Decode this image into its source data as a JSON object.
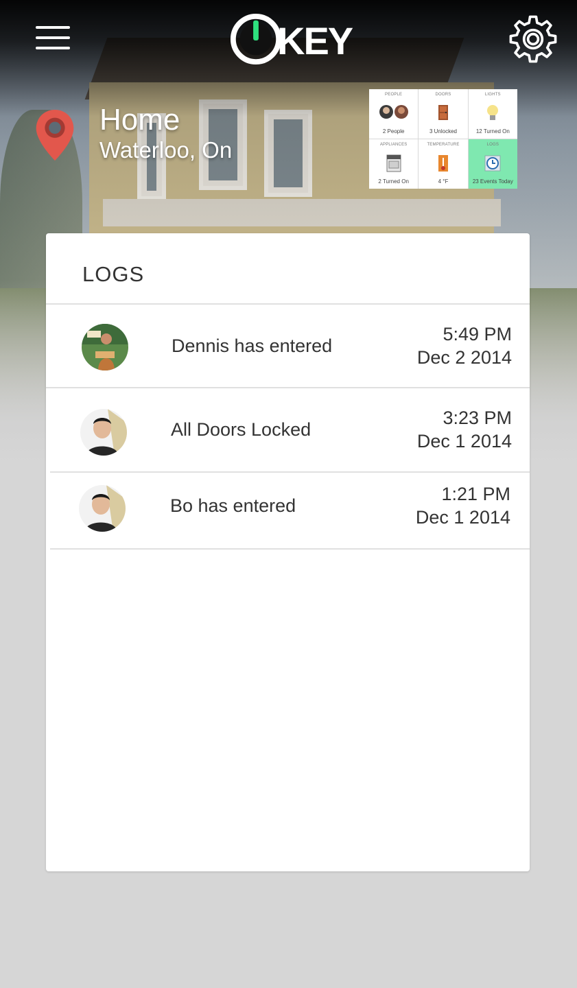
{
  "app": {
    "logo_text": "KEY"
  },
  "location": {
    "name": "Home",
    "subtitle": "Waterloo, On"
  },
  "status_grid": [
    {
      "label": "PEOPLE",
      "value": "2 People",
      "icon": "people-avatars-icon"
    },
    {
      "label": "DOORS",
      "value": "3 Unlocked",
      "icon": "door-icon"
    },
    {
      "label": "LIGHTS",
      "value": "12 Turned On",
      "icon": "lightbulb-icon"
    },
    {
      "label": "APPLIANCES",
      "value": "2 Turned On",
      "icon": "stove-icon"
    },
    {
      "label": "TEMPERATURE",
      "value": "4 °F",
      "icon": "thermometer-icon"
    },
    {
      "label": "LOGS",
      "value": "23 Events Today",
      "icon": "clock-log-icon"
    }
  ],
  "logs": {
    "title": "LOGS",
    "items": [
      {
        "message": "Dennis has entered",
        "time": "5:49 PM",
        "date": "Dec 2 2014"
      },
      {
        "message": "All Doors Locked",
        "time": "3:23 PM",
        "date": "Dec 1 2014"
      },
      {
        "message": "Bo has entered",
        "time": "1:21 PM",
        "date": "Dec 1 2014"
      }
    ]
  },
  "colors": {
    "accent_green": "#2ee07e",
    "active_tile": "#7fe8b0",
    "pin_red": "#e2574c"
  }
}
